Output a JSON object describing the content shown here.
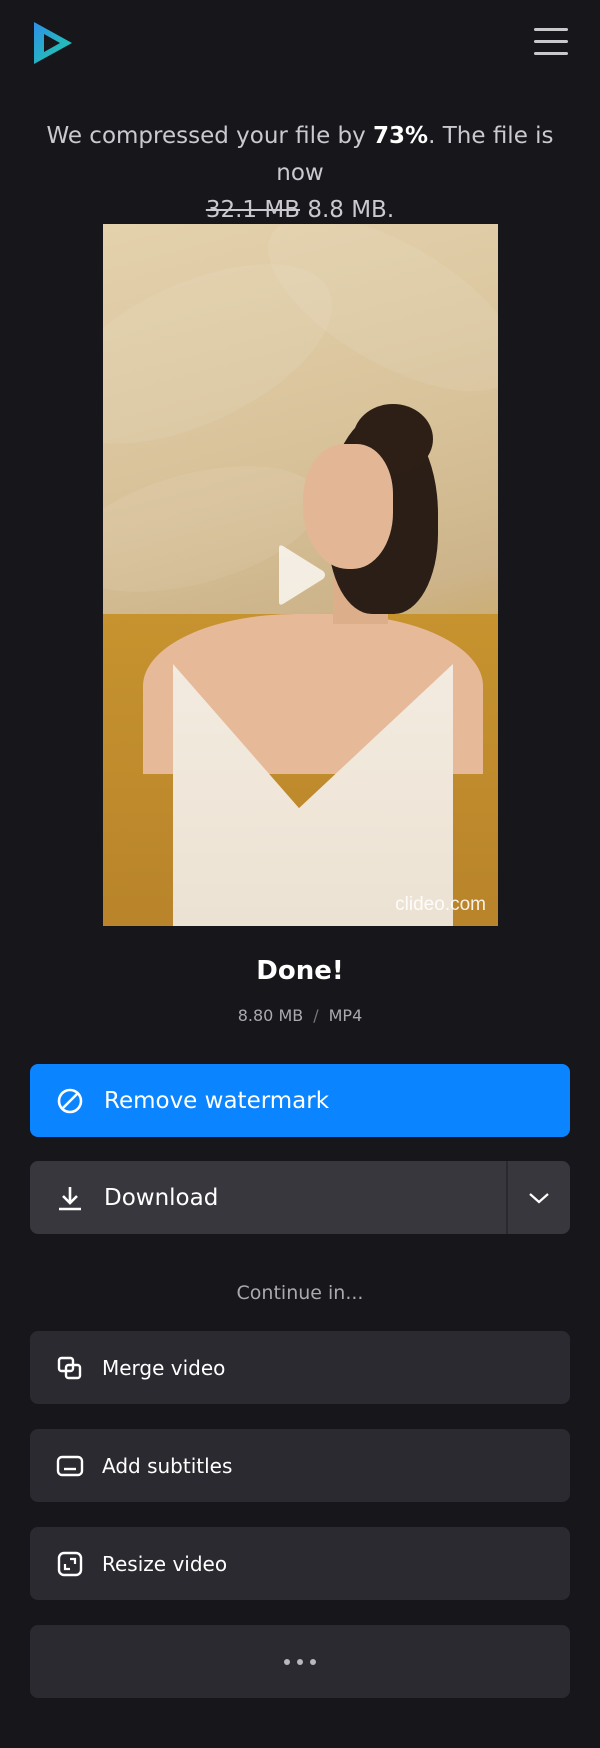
{
  "header": {
    "logo_icon": "clideo-logo-icon",
    "menu_icon": "hamburger-menu-icon"
  },
  "message": {
    "prefix": "We compressed your file by ",
    "percent": "73%",
    "middle": ". The file is now",
    "old_size": "32.1 MB",
    "new_size": "8.8 MB."
  },
  "video": {
    "play_icon": "play-icon",
    "watermark": "clideo.com"
  },
  "result": {
    "title": "Done!",
    "size": "8.80 MB",
    "separator": "/",
    "format": "MP4"
  },
  "actions": {
    "remove_watermark_label": "Remove watermark",
    "remove_watermark_icon": "prohibited-icon",
    "download_label": "Download",
    "download_icon": "download-icon",
    "download_dropdown_icon": "chevron-down-icon"
  },
  "continue": {
    "heading": "Continue in...",
    "tools": [
      {
        "label": "Merge video",
        "icon": "merge-icon"
      },
      {
        "label": "Add subtitles",
        "icon": "subtitles-icon"
      },
      {
        "label": "Resize video",
        "icon": "resize-icon"
      }
    ],
    "more_icon": "more-dots-icon"
  },
  "colors": {
    "background": "#17161b",
    "primary": "#0a84ff",
    "button_dark": "#38373d",
    "tool_bg": "#2b2a30"
  }
}
